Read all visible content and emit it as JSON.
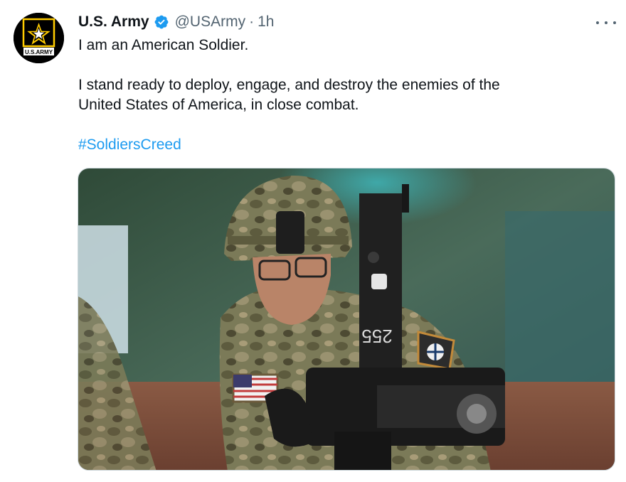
{
  "tweet": {
    "author": {
      "display_name": "U.S. Army",
      "handle": "@USArmy",
      "verified": true,
      "avatar_text": "U.S.ARMY"
    },
    "separator": "·",
    "time": "1h",
    "text_lines": [
      "I am an American Soldier.",
      "I stand ready to deploy, engage, and destroy the enemies of the",
      "United States of America, in close combat."
    ],
    "hashtag": "#SoldiersCreed",
    "media": {
      "icon": "soldier-with-machine-gun-photo",
      "gun_number": "255"
    }
  },
  "colors": {
    "link": "#1d9bf0",
    "secondary_text": "#536471",
    "verified_badge": "#1d9bf0",
    "army_gold": "#ffcc00"
  }
}
